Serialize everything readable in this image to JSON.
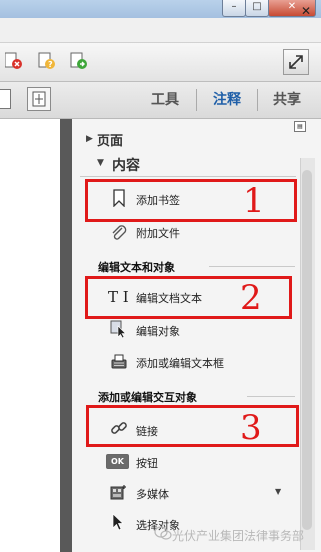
{
  "window": {
    "min_glyph": "–",
    "max_glyph": "□",
    "close_glyph": "✕"
  },
  "panel_close_glyph": "✕",
  "tabs": [
    {
      "label": "工具"
    },
    {
      "label": "注释"
    },
    {
      "label": "共享"
    }
  ],
  "tools_panel": {
    "sections": {
      "pages": "页面",
      "content": "内容"
    },
    "groups": {
      "edit_text_objects": "编辑文本和对象",
      "interactive_objects": "添加或编辑交互对象"
    },
    "items": {
      "add_bookmark": "添加书签",
      "attach_file": "附加文件",
      "edit_document_text": "编辑文档文本",
      "edit_object": "编辑对象",
      "add_edit_textbox": "添加或编辑文本框",
      "link": "链接",
      "button": "按钮",
      "multimedia": "多媒体",
      "select_object": "选择对象"
    },
    "text_tool_icon": "T I",
    "button_icon_text": "OK"
  },
  "annotations": [
    "1",
    "2",
    "3"
  ],
  "watermark": "光伏产业集团法律事务部",
  "colors": {
    "accent_tab": "#1f5fa8",
    "annotation_red": "#e01919"
  }
}
